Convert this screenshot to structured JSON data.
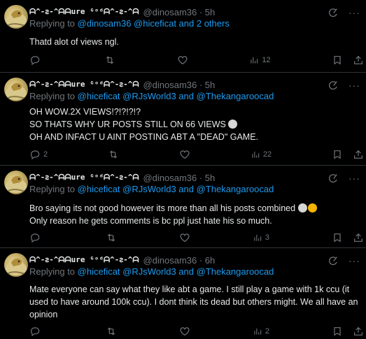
{
  "tweets": [
    {
      "display_name": "ᗩ^-ꙅ-^ᗩᗩure ᴳᵒᵈᗩ^-ꙅ-^ᗩ",
      "handle": "@dinosam36 · 5h",
      "replying_prefix": "Replying to ",
      "replying_to": "@dinosam36 @hiceficat and 2 others",
      "text_lines": [
        "Thatd alot of views ngl."
      ],
      "replies": "",
      "views": "12"
    },
    {
      "display_name": "ᗩ^-ꙅ-^ᗩᗩure ᴳᵒᵈᗩ^-ꙅ-^ᗩ",
      "handle": "@dinosam36 · 5h",
      "replying_prefix": "Replying to ",
      "replying_to": "@hiceficat @RJsWorld3 and @Thekangaroocad",
      "text_lines": [
        "OH WOW.2X VIEWS!?!?!?!?",
        "SO THATS WHY UR POSTS STILL ON 66 VIEWS",
        "OH AND INFACT U AINT POSTING ABT A \"DEAD\" GAME."
      ],
      "replies": "2",
      "views": "22"
    },
    {
      "display_name": "ᗩ^-ꙅ-^ᗩᗩure ᴳᵒᵈᗩ^-ꙅ-^ᗩ",
      "handle": "@dinosam36 · 5h",
      "replying_prefix": "Replying to ",
      "replying_to": "@hiceficat @RJsWorld3 and @Thekangaroocad",
      "text_lines": [
        "Bro saying its not good however its more than all his posts combined",
        "Only reason he gets comments is bc ppl just hate his so much."
      ],
      "replies": "",
      "views": "3"
    },
    {
      "display_name": "ᗩ^-ꙅ-^ᗩᗩure ᴳᵒᵈᗩ^-ꙅ-^ᗩ",
      "handle": "@dinosam36 · 6h",
      "replying_prefix": "Replying to ",
      "replying_to": "@hiceficat @RJsWorld3 and @Thekangaroocad",
      "text_lines": [
        "Mate everyone can say what they like abt a game. I still play a game with 1k ccu (it",
        "used to have around 100k ccu). I dont think its dead but others might. We all have an",
        "opinion"
      ],
      "replies": "",
      "views": "2"
    }
  ],
  "colors": {
    "bg": "#000000",
    "text": "#e7e9ea",
    "muted": "#71767b",
    "link": "#1d9bf0",
    "divider": "#2f3336"
  },
  "icons": [
    "avatar",
    "grok-icon",
    "more-icon",
    "reply-icon",
    "retweet-icon",
    "like-icon",
    "views-icon",
    "bookmark-icon",
    "share-icon",
    "skull-icon",
    "crying-face-icon"
  ]
}
